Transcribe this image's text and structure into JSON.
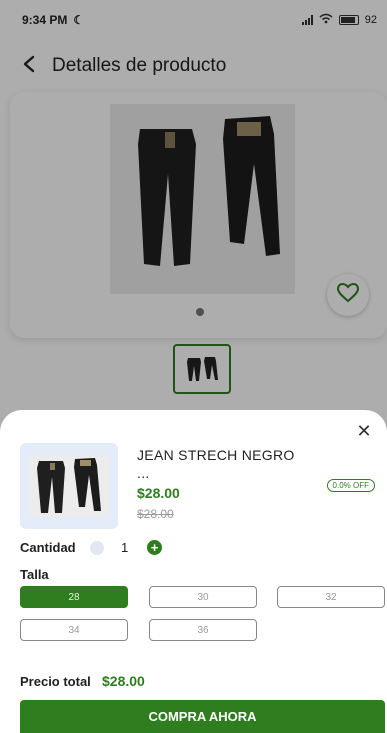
{
  "status_bar": {
    "time": "9:34 PM",
    "battery": "92"
  },
  "header": {
    "title": "Detalles de producto"
  },
  "product": {
    "name": "JEAN STRECH NEGRO ...",
    "price": "$28.00",
    "old_price": "$28.00",
    "discount": "0.0% OFF"
  },
  "quantity": {
    "label": "Cantidad",
    "value": "1"
  },
  "sizes": {
    "label": "Talla",
    "options": [
      "28",
      "30",
      "32",
      "34",
      "36"
    ],
    "selected": "28"
  },
  "total": {
    "label": "Precio total",
    "value": "$28.00"
  },
  "buy_button": {
    "label": "COMPRA AHORA"
  },
  "colors": {
    "accent": "#2e7d1e",
    "thumb_bg": "#e3ecf8"
  },
  "icons": [
    "back-arrow-icon",
    "heart-icon",
    "close-icon",
    "plus-icon",
    "signal-icon",
    "wifi-icon",
    "battery-icon",
    "moon-icon"
  ]
}
